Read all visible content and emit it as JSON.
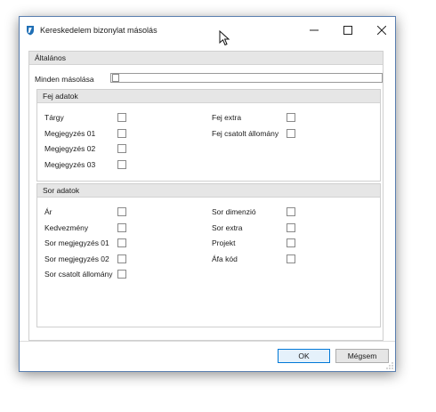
{
  "window": {
    "title": "Kereskedelem bizonylat másolás",
    "controls": {
      "minimize": "minimize-icon",
      "maximize": "maximize-icon",
      "close": "close-icon"
    }
  },
  "general": {
    "header": "Általános",
    "copy_all_label": "Minden másolása"
  },
  "head_data": {
    "header": "Fej adatok",
    "left": [
      "Tárgy",
      "Megjegyzés 01",
      "Megjegyzés 02",
      "Megjegyzés 03"
    ],
    "right": [
      "Fej extra",
      "Fej csatolt állomány"
    ]
  },
  "row_data": {
    "header": "Sor adatok",
    "left": [
      "Ár",
      "Kedvezmény",
      "Sor megjegyzés 01",
      "Sor megjegyzés 02",
      "Sor csatolt állomány"
    ],
    "right": [
      "Sor dimenzió",
      "Sor extra",
      "Projekt",
      "Áfa kód"
    ]
  },
  "buttons": {
    "ok": "OK",
    "cancel": "Mégsem"
  },
  "colors": {
    "accent": "#0078d7",
    "group_header_bg": "#e6e6e6",
    "app_icon": "#1f6fb5"
  }
}
